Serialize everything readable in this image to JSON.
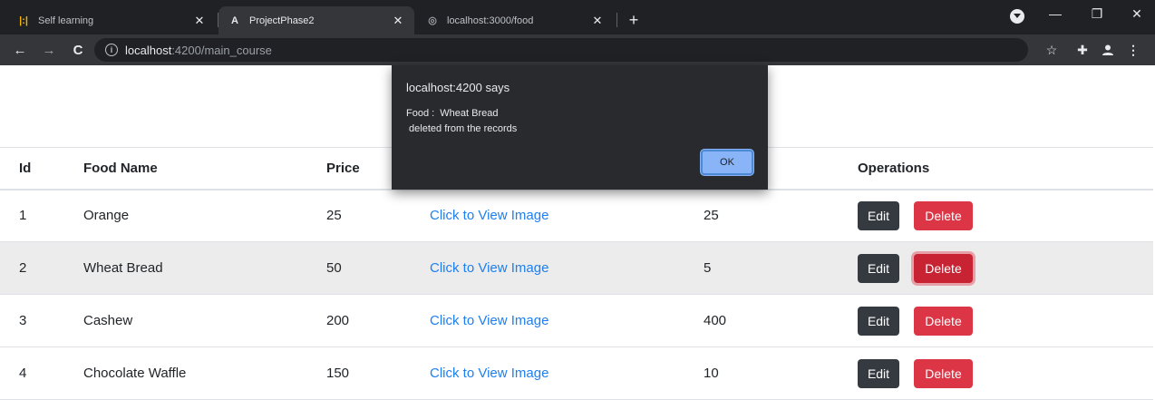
{
  "browser": {
    "tabs": [
      {
        "title": "Self learning",
        "favicon": "jira-icon",
        "active": false
      },
      {
        "title": "ProjectPhase2",
        "favicon": "angular-icon",
        "active": true
      },
      {
        "title": "localhost:3000/food",
        "favicon": "globe-icon",
        "active": false
      }
    ],
    "url_host": "localhost",
    "url_rest": ":4200/main_course"
  },
  "dialog": {
    "title": "localhost:4200 says",
    "message": "Food :  Wheat Bread\n deleted from the records",
    "ok_label": "OK"
  },
  "table": {
    "headers": [
      "Id",
      "Food Name",
      "Price",
      "",
      "",
      "Operations"
    ],
    "rows": [
      {
        "id": "1",
        "name": "Orange",
        "price": "25",
        "image_link": "Click to View Image",
        "qty": "25"
      },
      {
        "id": "2",
        "name": "Wheat Bread",
        "price": "50",
        "image_link": "Click to View Image",
        "qty": "5"
      },
      {
        "id": "3",
        "name": "Cashew",
        "price": "200",
        "image_link": "Click to View Image",
        "qty": "400"
      },
      {
        "id": "4",
        "name": "Chocolate Waffle",
        "price": "150",
        "image_link": "Click to View Image",
        "qty": "10"
      }
    ],
    "edit_label": "Edit",
    "delete_label": "Delete"
  },
  "colors": {
    "edit": "#343a40",
    "delete": "#dc3545",
    "link": "#1e7ff0"
  }
}
